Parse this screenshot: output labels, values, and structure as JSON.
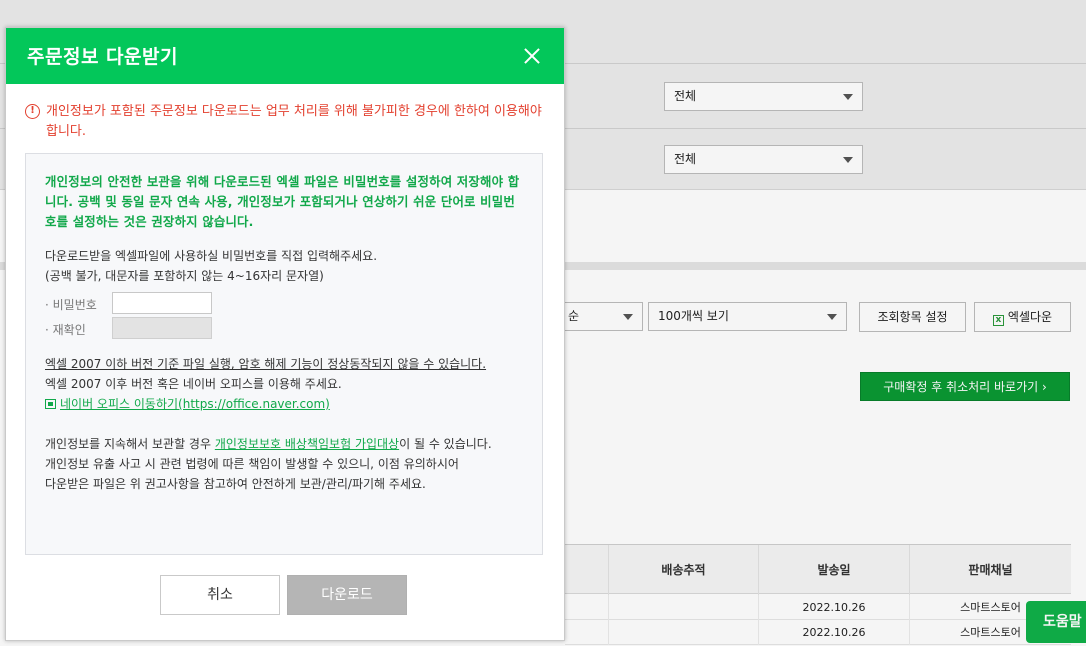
{
  "background": {
    "filter_select_1": "전체",
    "filter_select_2": "전체",
    "sort_select": "순",
    "page_size_select": "100개씩 보기",
    "column_setting_button": "조회항목 설정",
    "excel_download_button": "엑셀다운",
    "confirm_cancel_button": "구매확정 후 취소처리 바로가기 ›",
    "table": {
      "headers": [
        "배송추적",
        "발송일",
        "판매채널"
      ],
      "rows": [
        {
          "date": "2022.10.26",
          "channel": "스마트스토어"
        },
        {
          "date": "2022.10.26",
          "channel": "스마트스토어"
        }
      ]
    },
    "help_button": "도움말"
  },
  "modal": {
    "title": "주문정보 다운받기",
    "warning_icon": "!",
    "warning_text": "개인정보가 포함된 주문정보 다운로드는 업무 처리를 위해 불가피한 경우에 한하여 이용해야 합니다.",
    "green_notice": "개인정보의 안전한 보관을 위해 다운로드된 엑셀 파일은 비밀번호를 설정하여 저장해야 합니다. 공백 및 동일 문자 연속 사용, 개인정보가 포함되거나 연상하기 쉬운 단어로 비밀번호를 설정하는 것은 권장하지 않습니다.",
    "password_instruction": "다운로드받을 엑셀파일에 사용하실 비밀번호를 직접 입력해주세요.",
    "password_rule": "(공백 불가, 대문자를 포함하지 않는 4~16자리 문자열)",
    "password_label": "· 비밀번호",
    "confirm_label": "· 재확인",
    "excel_warning": "엑셀 2007 이하 버전 기준 파일 실행, 암호 해제 기능이 정상동작되지 않을 수 있습니다.",
    "excel_recommend": "엑셀 2007 이후 버전 혹은 네이버 오피스를 이용해 주세요.",
    "office_link": "네이버 오피스 이동하기(https://office.naver.com)",
    "keep_info_prefix": "개인정보를 지속해서 보관할 경우 ",
    "keep_info_link": "개인정보보호 배상책임보험 가입대상",
    "keep_info_suffix": "이 될 수 있습니다.",
    "responsibility_line1": "개인정보 유출 사고 시 관련 법령에 따른 책임이 발생할 수 있으니, 이점 유의하시어",
    "responsibility_line2": "다운받은 파일은 위 권고사항을 참고하여 안전하게 보관/관리/파기해 주세요.",
    "cancel_button": "취소",
    "download_button": "다운로드"
  }
}
